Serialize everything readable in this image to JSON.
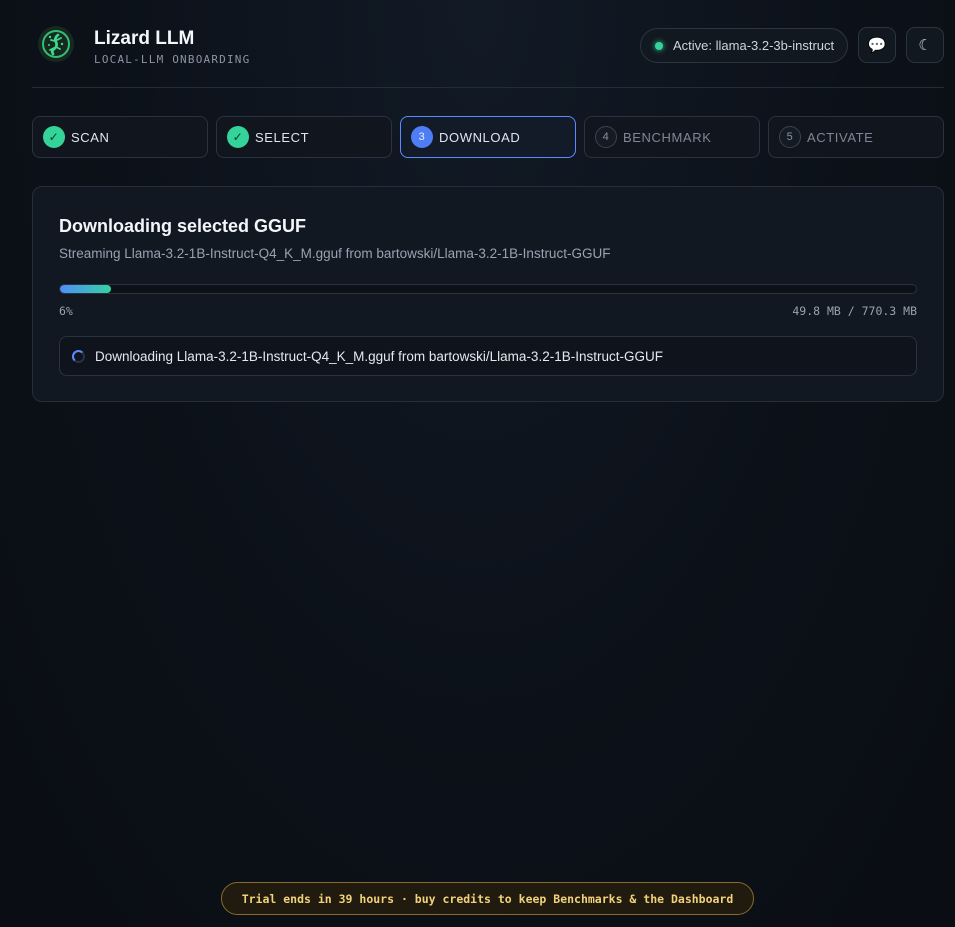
{
  "header": {
    "title": "Lizard LLM",
    "subtitle": "LOCAL-LLM ONBOARDING",
    "logo_icon": "lizard-logo-icon",
    "active_model": "Active: llama-3.2-3b-instruct",
    "chat_icon": "💬",
    "theme_icon": "☾"
  },
  "steps": [
    {
      "number": "✓",
      "label": "SCAN",
      "state": "done"
    },
    {
      "number": "✓",
      "label": "SELECT",
      "state": "done"
    },
    {
      "number": "3",
      "label": "DOWNLOAD",
      "state": "active"
    },
    {
      "number": "4",
      "label": "BENCHMARK",
      "state": "pending"
    },
    {
      "number": "5",
      "label": "ACTIVATE",
      "state": "pending"
    }
  ],
  "download": {
    "title": "Downloading selected GGUF",
    "subtitle": "Streaming Llama-3.2-1B-Instruct-Q4_K_M.gguf from bartowski/Llama-3.2-1B-Instruct-GGUF",
    "progress_percent": 6,
    "progress_label": "6%",
    "size_label": "49.8 MB / 770.3 MB",
    "status": "Downloading Llama-3.2-1B-Instruct-Q4_K_M.gguf from bartowski/Llama-3.2-1B-Instruct-GGUF"
  },
  "trial_banner": "Trial ends in 39 hours · buy credits to keep Benchmarks & the Dashboard",
  "colors": {
    "accent": "#5b8cff",
    "success": "#34d399",
    "warning": "#f1d27a"
  }
}
